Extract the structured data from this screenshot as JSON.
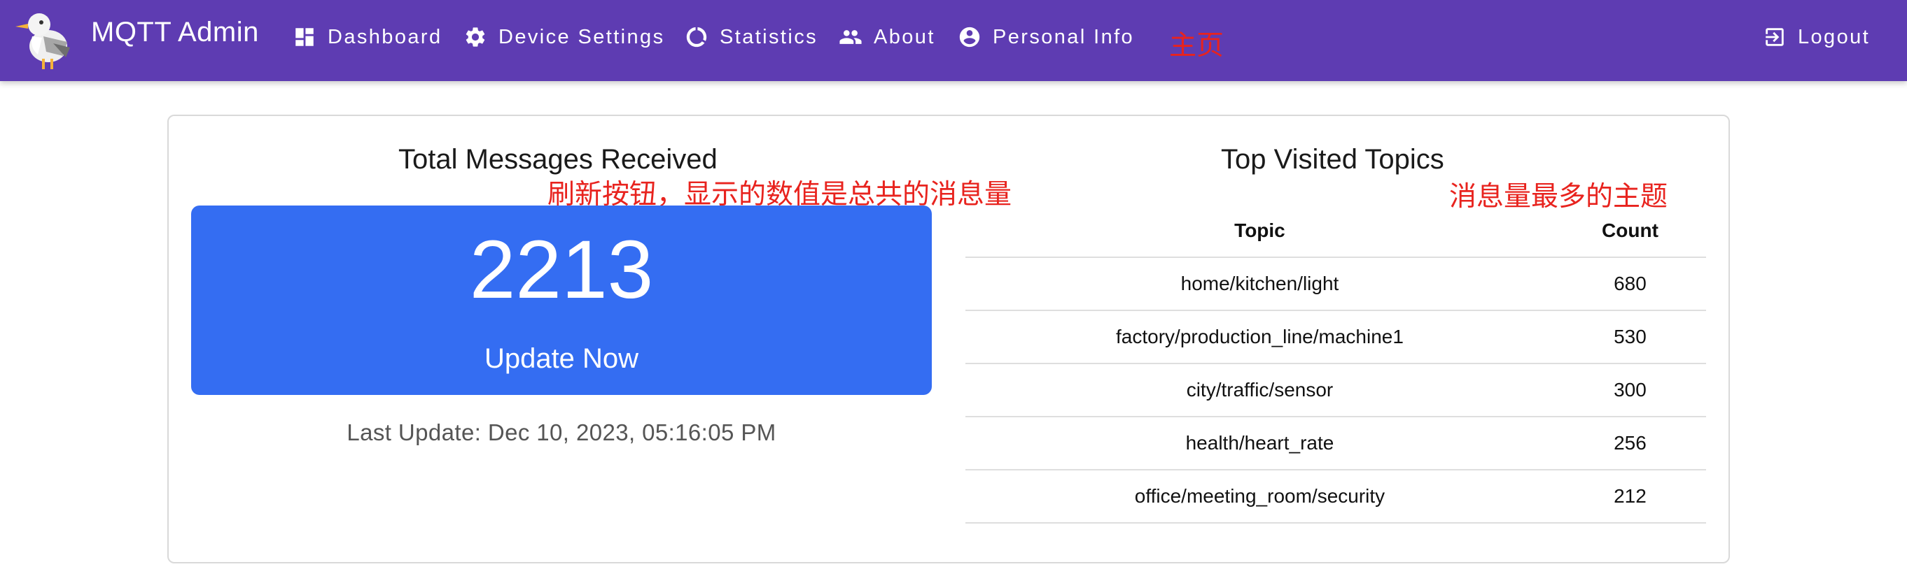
{
  "app": {
    "title": "MQTT Admin"
  },
  "nav": {
    "items": [
      {
        "label": "Dashboard",
        "icon": "dashboard-icon"
      },
      {
        "label": "Device Settings",
        "icon": "gear-icon"
      },
      {
        "label": "Statistics",
        "icon": "donut-chart-icon"
      },
      {
        "label": "About",
        "icon": "people-icon"
      },
      {
        "label": "Personal Info",
        "icon": "account-circle-icon"
      }
    ],
    "logout": {
      "label": "Logout",
      "icon": "logout-icon"
    }
  },
  "annotations": {
    "home": "主页",
    "refresh": "刷新按钮，显示的数值是总共的消息量",
    "topics": "消息量最多的主题"
  },
  "messages": {
    "title": "Total Messages Received",
    "total": "2213",
    "update_label": "Update Now",
    "last_update": "Last Update: Dec 10, 2023, 05:16:05 PM"
  },
  "topics": {
    "title": "Top Visited Topics",
    "headers": [
      "Topic",
      "Count"
    ],
    "rows": [
      [
        "home/kitchen/light",
        "680"
      ],
      [
        "factory/production_line/machine1",
        "530"
      ],
      [
        "city/traffic/sensor",
        "300"
      ],
      [
        "health/heart_rate",
        "256"
      ],
      [
        "office/meeting_room/security",
        "212"
      ]
    ]
  },
  "colors": {
    "navbar": "#5e3cb2",
    "accent_button": "#346df2",
    "annotation": "#e8231e"
  }
}
